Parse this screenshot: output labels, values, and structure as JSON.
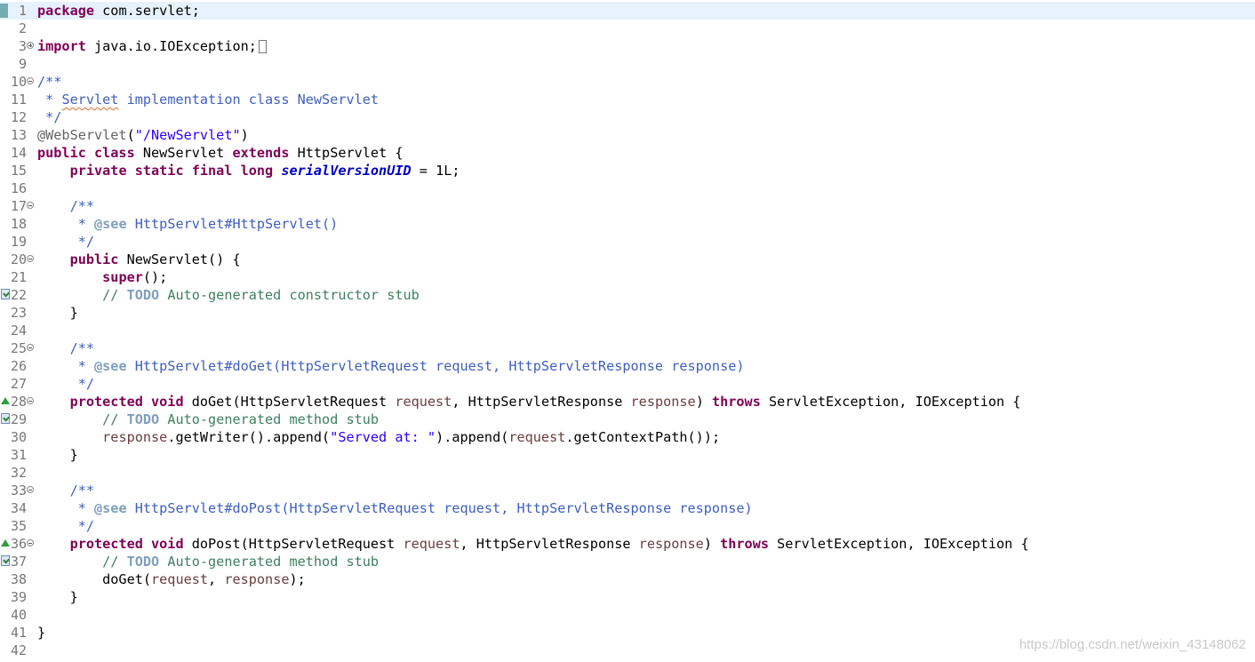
{
  "editor": {
    "lines": [
      {
        "num": "1",
        "current": true,
        "marker": "highlight",
        "fold": "",
        "segments": [
          {
            "cls": "kw",
            "text": "package"
          },
          {
            "cls": "ty",
            "text": " com.servlet;"
          }
        ]
      },
      {
        "num": "2",
        "segments": []
      },
      {
        "num": "3",
        "fold": "collapsed",
        "segments": [
          {
            "cls": "kw",
            "text": "import"
          },
          {
            "cls": "ty",
            "text": " java.io.IOException;"
          },
          {
            "cls": "ellipsis",
            "text": ""
          }
        ]
      },
      {
        "num": "9",
        "segments": []
      },
      {
        "num": "10",
        "fold": "expanded",
        "segments": [
          {
            "cls": "cm",
            "text": "/**"
          }
        ]
      },
      {
        "num": "11",
        "segments": [
          {
            "cls": "cm",
            "text": " * "
          },
          {
            "cls": "cm spell",
            "text": "Servlet"
          },
          {
            "cls": "cm",
            "text": " implementation class NewServlet"
          }
        ]
      },
      {
        "num": "12",
        "segments": [
          {
            "cls": "cm",
            "text": " */"
          }
        ]
      },
      {
        "num": "13",
        "segments": [
          {
            "cls": "ann",
            "text": "@WebServlet"
          },
          {
            "cls": "ty",
            "text": "("
          },
          {
            "cls": "str",
            "text": "\"/NewServlet\""
          },
          {
            "cls": "ty",
            "text": ")"
          }
        ]
      },
      {
        "num": "14",
        "segments": [
          {
            "cls": "kw",
            "text": "public class"
          },
          {
            "cls": "ty",
            "text": " NewServlet "
          },
          {
            "cls": "kw",
            "text": "extends"
          },
          {
            "cls": "ty",
            "text": " HttpServlet {"
          }
        ]
      },
      {
        "num": "15",
        "segments": [
          {
            "cls": "ty",
            "text": "    "
          },
          {
            "cls": "kw",
            "text": "private static final long"
          },
          {
            "cls": "ty",
            "text": " "
          },
          {
            "cls": "fld",
            "text": "serialVersionUID"
          },
          {
            "cls": "ty",
            "text": " = 1L;"
          }
        ]
      },
      {
        "num": "16",
        "segments": []
      },
      {
        "num": "17",
        "fold": "expanded",
        "segments": [
          {
            "cls": "cm",
            "text": "    /**"
          }
        ]
      },
      {
        "num": "18",
        "segments": [
          {
            "cls": "cm",
            "text": "     * "
          },
          {
            "cls": "tag",
            "text": "@see"
          },
          {
            "cls": "cm",
            "text": " HttpServlet#HttpServlet()"
          }
        ]
      },
      {
        "num": "19",
        "segments": [
          {
            "cls": "cm",
            "text": "     */"
          }
        ]
      },
      {
        "num": "20",
        "fold": "expanded",
        "segments": [
          {
            "cls": "ty",
            "text": "    "
          },
          {
            "cls": "kw",
            "text": "public"
          },
          {
            "cls": "ty",
            "text": " NewServlet() {"
          }
        ]
      },
      {
        "num": "21",
        "segments": [
          {
            "cls": "ty",
            "text": "        "
          },
          {
            "cls": "kw",
            "text": "super"
          },
          {
            "cls": "ty",
            "text": "();"
          }
        ]
      },
      {
        "num": "22",
        "marker": "task",
        "segments": [
          {
            "cls": "lc",
            "text": "        // "
          },
          {
            "cls": "todo",
            "text": "TODO"
          },
          {
            "cls": "lc",
            "text": " Auto-generated constructor stub"
          }
        ]
      },
      {
        "num": "23",
        "segments": [
          {
            "cls": "ty",
            "text": "    }"
          }
        ]
      },
      {
        "num": "24",
        "segments": []
      },
      {
        "num": "25",
        "fold": "expanded",
        "segments": [
          {
            "cls": "cm",
            "text": "    /**"
          }
        ]
      },
      {
        "num": "26",
        "segments": [
          {
            "cls": "cm",
            "text": "     * "
          },
          {
            "cls": "tag",
            "text": "@see"
          },
          {
            "cls": "cm",
            "text": " HttpServlet#doGet(HttpServletRequest request, HttpServletResponse response)"
          }
        ]
      },
      {
        "num": "27",
        "segments": [
          {
            "cls": "cm",
            "text": "     */"
          }
        ]
      },
      {
        "num": "28",
        "marker": "override",
        "fold": "expanded",
        "segments": [
          {
            "cls": "ty",
            "text": "    "
          },
          {
            "cls": "kw",
            "text": "protected void"
          },
          {
            "cls": "ty",
            "text": " doGet(HttpServletRequest "
          },
          {
            "cls": "prm",
            "text": "request"
          },
          {
            "cls": "ty",
            "text": ", HttpServletResponse "
          },
          {
            "cls": "prm",
            "text": "response"
          },
          {
            "cls": "ty",
            "text": ") "
          },
          {
            "cls": "kw",
            "text": "throws"
          },
          {
            "cls": "ty",
            "text": " ServletException, IOException {"
          }
        ]
      },
      {
        "num": "29",
        "marker": "task",
        "segments": [
          {
            "cls": "lc",
            "text": "        // "
          },
          {
            "cls": "todo",
            "text": "TODO"
          },
          {
            "cls": "lc",
            "text": " Auto-generated method stub"
          }
        ]
      },
      {
        "num": "30",
        "segments": [
          {
            "cls": "ty",
            "text": "        "
          },
          {
            "cls": "prm",
            "text": "response"
          },
          {
            "cls": "ty",
            "text": ".getWriter().append("
          },
          {
            "cls": "str",
            "text": "\"Served at: \""
          },
          {
            "cls": "ty",
            "text": ").append("
          },
          {
            "cls": "prm",
            "text": "request"
          },
          {
            "cls": "ty",
            "text": ".getContextPath());"
          }
        ]
      },
      {
        "num": "31",
        "segments": [
          {
            "cls": "ty",
            "text": "    }"
          }
        ]
      },
      {
        "num": "32",
        "segments": []
      },
      {
        "num": "33",
        "fold": "expanded",
        "segments": [
          {
            "cls": "cm",
            "text": "    /**"
          }
        ]
      },
      {
        "num": "34",
        "segments": [
          {
            "cls": "cm",
            "text": "     * "
          },
          {
            "cls": "tag",
            "text": "@see"
          },
          {
            "cls": "cm",
            "text": " HttpServlet#doPost(HttpServletRequest request, HttpServletResponse response)"
          }
        ]
      },
      {
        "num": "35",
        "segments": [
          {
            "cls": "cm",
            "text": "     */"
          }
        ]
      },
      {
        "num": "36",
        "marker": "override",
        "fold": "expanded",
        "segments": [
          {
            "cls": "ty",
            "text": "    "
          },
          {
            "cls": "kw",
            "text": "protected void"
          },
          {
            "cls": "ty",
            "text": " doPost(HttpServletRequest "
          },
          {
            "cls": "prm",
            "text": "request"
          },
          {
            "cls": "ty",
            "text": ", HttpServletResponse "
          },
          {
            "cls": "prm",
            "text": "response"
          },
          {
            "cls": "ty",
            "text": ") "
          },
          {
            "cls": "kw",
            "text": "throws"
          },
          {
            "cls": "ty",
            "text": " ServletException, IOException {"
          }
        ]
      },
      {
        "num": "37",
        "marker": "task",
        "segments": [
          {
            "cls": "lc",
            "text": "        // "
          },
          {
            "cls": "todo",
            "text": "TODO"
          },
          {
            "cls": "lc",
            "text": " Auto-generated method stub"
          }
        ]
      },
      {
        "num": "38",
        "segments": [
          {
            "cls": "ty",
            "text": "        doGet("
          },
          {
            "cls": "prm",
            "text": "request"
          },
          {
            "cls": "ty",
            "text": ", "
          },
          {
            "cls": "prm",
            "text": "response"
          },
          {
            "cls": "ty",
            "text": ");"
          }
        ]
      },
      {
        "num": "39",
        "segments": [
          {
            "cls": "ty",
            "text": "    }"
          }
        ]
      },
      {
        "num": "40",
        "segments": []
      },
      {
        "num": "41",
        "segments": [
          {
            "cls": "ty",
            "text": "}"
          }
        ]
      },
      {
        "num": "42",
        "segments": []
      }
    ]
  },
  "watermark": "https://blog.csdn.net/weixin_43148062",
  "colors": {
    "keyword": "#7f0055",
    "javadoc": "#3f5fbf",
    "line_comment": "#3f7f5f",
    "string": "#2a00ff",
    "annotation": "#646464",
    "field": "#0000c0",
    "parameter": "#6a3e3e",
    "current_line": "#e8f2fe"
  }
}
